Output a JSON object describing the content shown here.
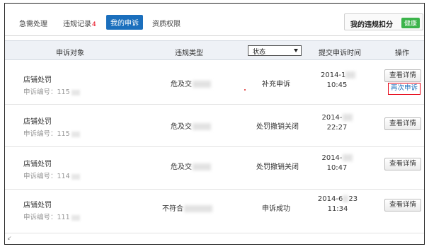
{
  "tabs": [
    {
      "label": "急需处理"
    },
    {
      "label": "违规记录",
      "count": "4"
    },
    {
      "label": "我的申诉"
    },
    {
      "label": "资质权限"
    }
  ],
  "score": {
    "label": "我的违规扣分",
    "badge": "健康"
  },
  "table": {
    "headers": {
      "object": "申诉对象",
      "type": "违规类型",
      "status_select": "状态",
      "time": "提交申诉时间",
      "action": "操作"
    },
    "rows": [
      {
        "object": "店铺处罚",
        "number": "申诉编号：115",
        "type": "危及交",
        "status": "补充申诉",
        "date": "2014-1",
        "time": "10:45",
        "detail": "查看详情",
        "reappeal": "再次申诉"
      },
      {
        "object": "店铺处罚",
        "number": "申诉编号：115",
        "type": "危及交",
        "status": "处罚撤销关闭",
        "date": "2014-",
        "time": "22:27",
        "detail": "查看详情"
      },
      {
        "object": "店铺处罚",
        "number": "申诉编号：114",
        "type": "危及交",
        "status": "处罚撤销关闭",
        "date": "2014-",
        "time": "10:47",
        "detail": "查看详情"
      },
      {
        "object": "店铺处罚",
        "number": "申诉编号：111",
        "type": "不符合",
        "status": "申诉成功",
        "date": "2014-6",
        "date_suffix": "23",
        "time": "11:34",
        "detail": "查看详情"
      }
    ]
  }
}
